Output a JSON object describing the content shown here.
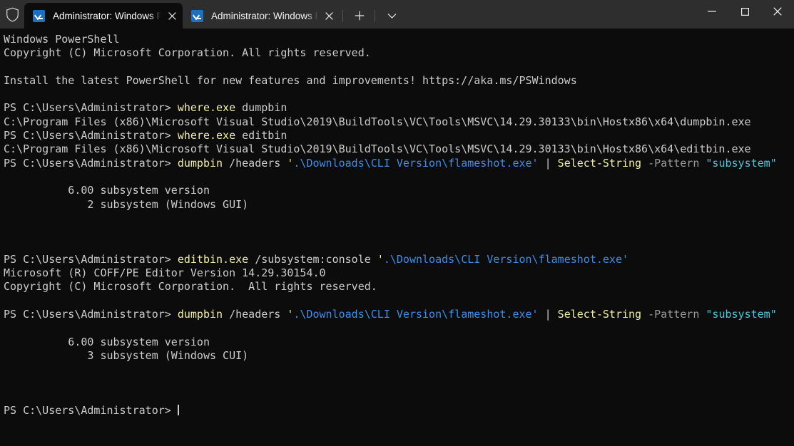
{
  "window": {
    "shield_icon": "shield-icon",
    "minimize_label": "—",
    "maximize_label": "□",
    "close_label": "✕",
    "new_tab_label": "+",
    "dropdown_label": "⌄"
  },
  "tabs": [
    {
      "title": "Administrator: Windows PowerShell",
      "icon": "powershell-icon",
      "close_label": "✕",
      "active": true
    },
    {
      "title": "Administrator: Windows PowerShell",
      "icon": "powershell-icon",
      "close_label": "✕",
      "active": false
    }
  ],
  "terminal": {
    "prompt": "PS C:\\Users\\Administrator> ",
    "cursor": "block-cursor",
    "colors": {
      "background": "#0c0c0c",
      "foreground": "#cccccc",
      "command_yellow": "#f2f0a0",
      "path_blue": "#3b8eea",
      "string_cyan": "#4fc4e0",
      "parameter_gray": "#9b9b9b"
    },
    "lines": [
      {
        "id": "l0",
        "segments": [
          {
            "text": "Windows PowerShell",
            "color": "default"
          }
        ]
      },
      {
        "id": "l1",
        "segments": [
          {
            "text": "Copyright (C) Microsoft Corporation. All rights reserved.",
            "color": "default"
          }
        ]
      },
      {
        "id": "l2",
        "segments": [
          {
            "text": "",
            "color": "default"
          }
        ]
      },
      {
        "id": "l3",
        "segments": [
          {
            "text": "Install the latest PowerShell for new features and improvements! https://aka.ms/PSWindows",
            "color": "default"
          }
        ]
      },
      {
        "id": "l4",
        "segments": [
          {
            "text": "",
            "color": "default"
          }
        ]
      },
      {
        "id": "l5",
        "segments": [
          {
            "text": "PS C:\\Users\\Administrator> ",
            "color": "default"
          },
          {
            "text": "where.exe",
            "color": "yellow"
          },
          {
            "text": " dumpbin",
            "color": "default"
          }
        ]
      },
      {
        "id": "l6",
        "segments": [
          {
            "text": "C:\\Program Files (x86)\\Microsoft Visual Studio\\2019\\BuildTools\\VC\\Tools\\MSVC\\14.29.30133\\bin\\Hostx86\\x64\\dumpbin.exe",
            "color": "default"
          }
        ]
      },
      {
        "id": "l7",
        "segments": [
          {
            "text": "PS C:\\Users\\Administrator> ",
            "color": "default"
          },
          {
            "text": "where.exe",
            "color": "yellow"
          },
          {
            "text": " editbin",
            "color": "default"
          }
        ]
      },
      {
        "id": "l8",
        "segments": [
          {
            "text": "C:\\Program Files (x86)\\Microsoft Visual Studio\\2019\\BuildTools\\VC\\Tools\\MSVC\\14.29.30133\\bin\\Hostx86\\x64\\editbin.exe",
            "color": "default"
          }
        ]
      },
      {
        "id": "l9",
        "segments": [
          {
            "text": "PS C:\\Users\\Administrator> ",
            "color": "default"
          },
          {
            "text": "dumpbin",
            "color": "yellow"
          },
          {
            "text": " /headers ",
            "color": "default"
          },
          {
            "text": "'",
            "color": "yellow"
          },
          {
            "text": ".\\Downloads\\CLI Version\\flameshot.exe'",
            "color": "blue"
          },
          {
            "text": " | ",
            "color": "default"
          },
          {
            "text": "Select-String",
            "color": "yellow"
          },
          {
            "text": " ",
            "color": "default"
          },
          {
            "text": "-Pattern",
            "color": "gray"
          },
          {
            "text": " ",
            "color": "default"
          },
          {
            "text": "\"subsystem\"",
            "color": "cyan"
          }
        ]
      },
      {
        "id": "l10",
        "segments": [
          {
            "text": "",
            "color": "default"
          }
        ]
      },
      {
        "id": "l11",
        "segments": [
          {
            "text": "          6.00 subsystem version",
            "color": "default"
          }
        ]
      },
      {
        "id": "l12",
        "segments": [
          {
            "text": "             2 subsystem (Windows GUI)",
            "color": "default"
          }
        ]
      },
      {
        "id": "l13",
        "segments": [
          {
            "text": "",
            "color": "default"
          }
        ]
      },
      {
        "id": "l14",
        "segments": [
          {
            "text": "",
            "color": "default"
          }
        ]
      },
      {
        "id": "l15",
        "segments": [
          {
            "text": "",
            "color": "default"
          }
        ]
      },
      {
        "id": "l16",
        "segments": [
          {
            "text": "PS C:\\Users\\Administrator> ",
            "color": "default"
          },
          {
            "text": "editbin.exe",
            "color": "yellow"
          },
          {
            "text": " /subsystem:console ",
            "color": "default"
          },
          {
            "text": "'",
            "color": "yellow"
          },
          {
            "text": ".\\Downloads\\CLI Version\\flameshot.exe'",
            "color": "blue"
          }
        ]
      },
      {
        "id": "l17",
        "segments": [
          {
            "text": "Microsoft (R) COFF/PE Editor Version 14.29.30154.0",
            "color": "default"
          }
        ]
      },
      {
        "id": "l18",
        "segments": [
          {
            "text": "Copyright (C) Microsoft Corporation.  All rights reserved.",
            "color": "default"
          }
        ]
      },
      {
        "id": "l19",
        "segments": [
          {
            "text": "",
            "color": "default"
          }
        ]
      },
      {
        "id": "l20",
        "segments": [
          {
            "text": "PS C:\\Users\\Administrator> ",
            "color": "default"
          },
          {
            "text": "dumpbin",
            "color": "yellow"
          },
          {
            "text": " /headers ",
            "color": "default"
          },
          {
            "text": "'",
            "color": "yellow"
          },
          {
            "text": ".\\Downloads\\CLI Version\\flameshot.exe'",
            "color": "blue"
          },
          {
            "text": " | ",
            "color": "default"
          },
          {
            "text": "Select-String",
            "color": "yellow"
          },
          {
            "text": " ",
            "color": "default"
          },
          {
            "text": "-Pattern",
            "color": "gray"
          },
          {
            "text": " ",
            "color": "default"
          },
          {
            "text": "\"subsystem\"",
            "color": "cyan"
          }
        ]
      },
      {
        "id": "l21",
        "segments": [
          {
            "text": "",
            "color": "default"
          }
        ]
      },
      {
        "id": "l22",
        "segments": [
          {
            "text": "          6.00 subsystem version",
            "color": "default"
          }
        ]
      },
      {
        "id": "l23",
        "segments": [
          {
            "text": "             3 subsystem (Windows CUI)",
            "color": "default"
          }
        ]
      },
      {
        "id": "l24",
        "segments": [
          {
            "text": "",
            "color": "default"
          }
        ]
      },
      {
        "id": "l25",
        "segments": [
          {
            "text": "",
            "color": "default"
          }
        ]
      },
      {
        "id": "l26",
        "segments": [
          {
            "text": "",
            "color": "default"
          }
        ]
      },
      {
        "id": "l27",
        "segments": [
          {
            "text": "PS C:\\Users\\Administrator> ",
            "color": "default",
            "cursor": true
          }
        ]
      }
    ]
  }
}
